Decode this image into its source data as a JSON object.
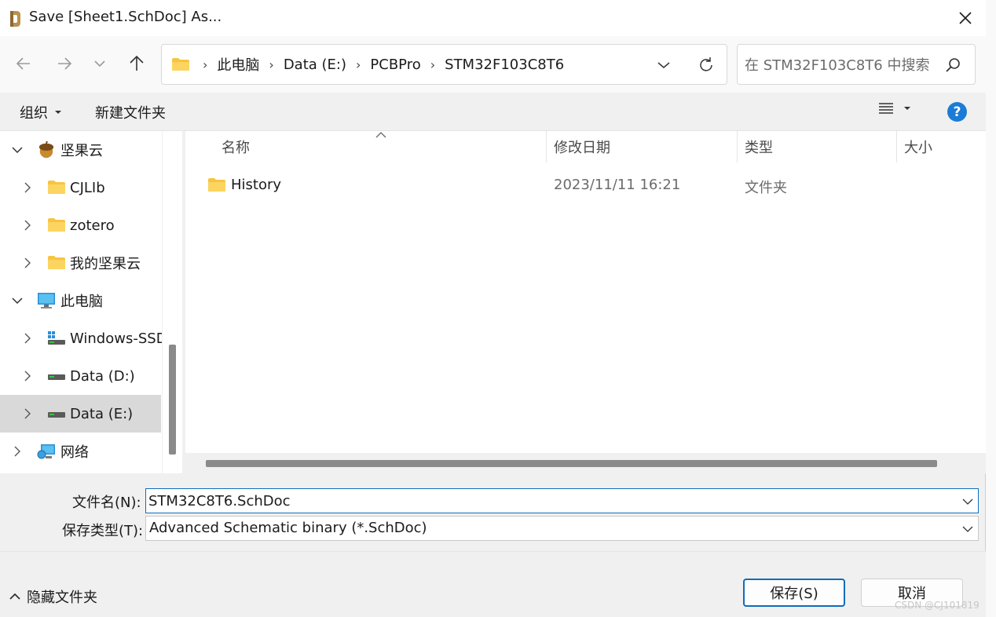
{
  "window": {
    "title": "Save [Sheet1.SchDoc] As..."
  },
  "nav": {
    "breadcrumbs": [
      "此电脑",
      "Data (E:)",
      "PCBPro",
      "STM32F103C8T6"
    ],
    "search_placeholder": "在 STM32F103C8T6 中搜索"
  },
  "toolbar": {
    "organize_label": "组织",
    "new_folder_label": "新建文件夹"
  },
  "sidebar": {
    "items": [
      {
        "label": "坚果云",
        "icon": "nutstore-icon",
        "expanded": true
      },
      {
        "label": "CJLIb",
        "icon": "folder-icon"
      },
      {
        "label": "zotero",
        "icon": "folder-icon"
      },
      {
        "label": "我的坚果云",
        "icon": "folder-icon"
      },
      {
        "label": "此电脑",
        "icon": "computer-icon",
        "expanded": true
      },
      {
        "label": "Windows-SSD",
        "icon": "windows-drive-icon"
      },
      {
        "label": "Data (D:)",
        "icon": "drive-icon"
      },
      {
        "label": "Data (E:)",
        "icon": "drive-icon",
        "selected": true
      },
      {
        "label": "网络",
        "icon": "network-icon"
      }
    ]
  },
  "filelist": {
    "columns": [
      "名称",
      "修改日期",
      "类型",
      "大小"
    ],
    "rows": [
      {
        "name": "History",
        "modified": "2023/11/11 16:21",
        "type": "文件夹",
        "size": ""
      }
    ]
  },
  "form": {
    "filename_label": "文件名(N):",
    "filename_value": "STM32C8T6.SchDoc",
    "filetype_label": "保存类型(T):",
    "filetype_value": "Advanced Schematic binary (*.SchDoc)"
  },
  "footer": {
    "hide_folders_label": "隐藏文件夹",
    "save_label": "保存(S)",
    "cancel_label": "取消"
  },
  "watermark": "CSDN @CJ101819",
  "colors": {
    "accent": "#0f6cbd",
    "folder": "#f8c43f",
    "help": "#1a7cd6"
  }
}
